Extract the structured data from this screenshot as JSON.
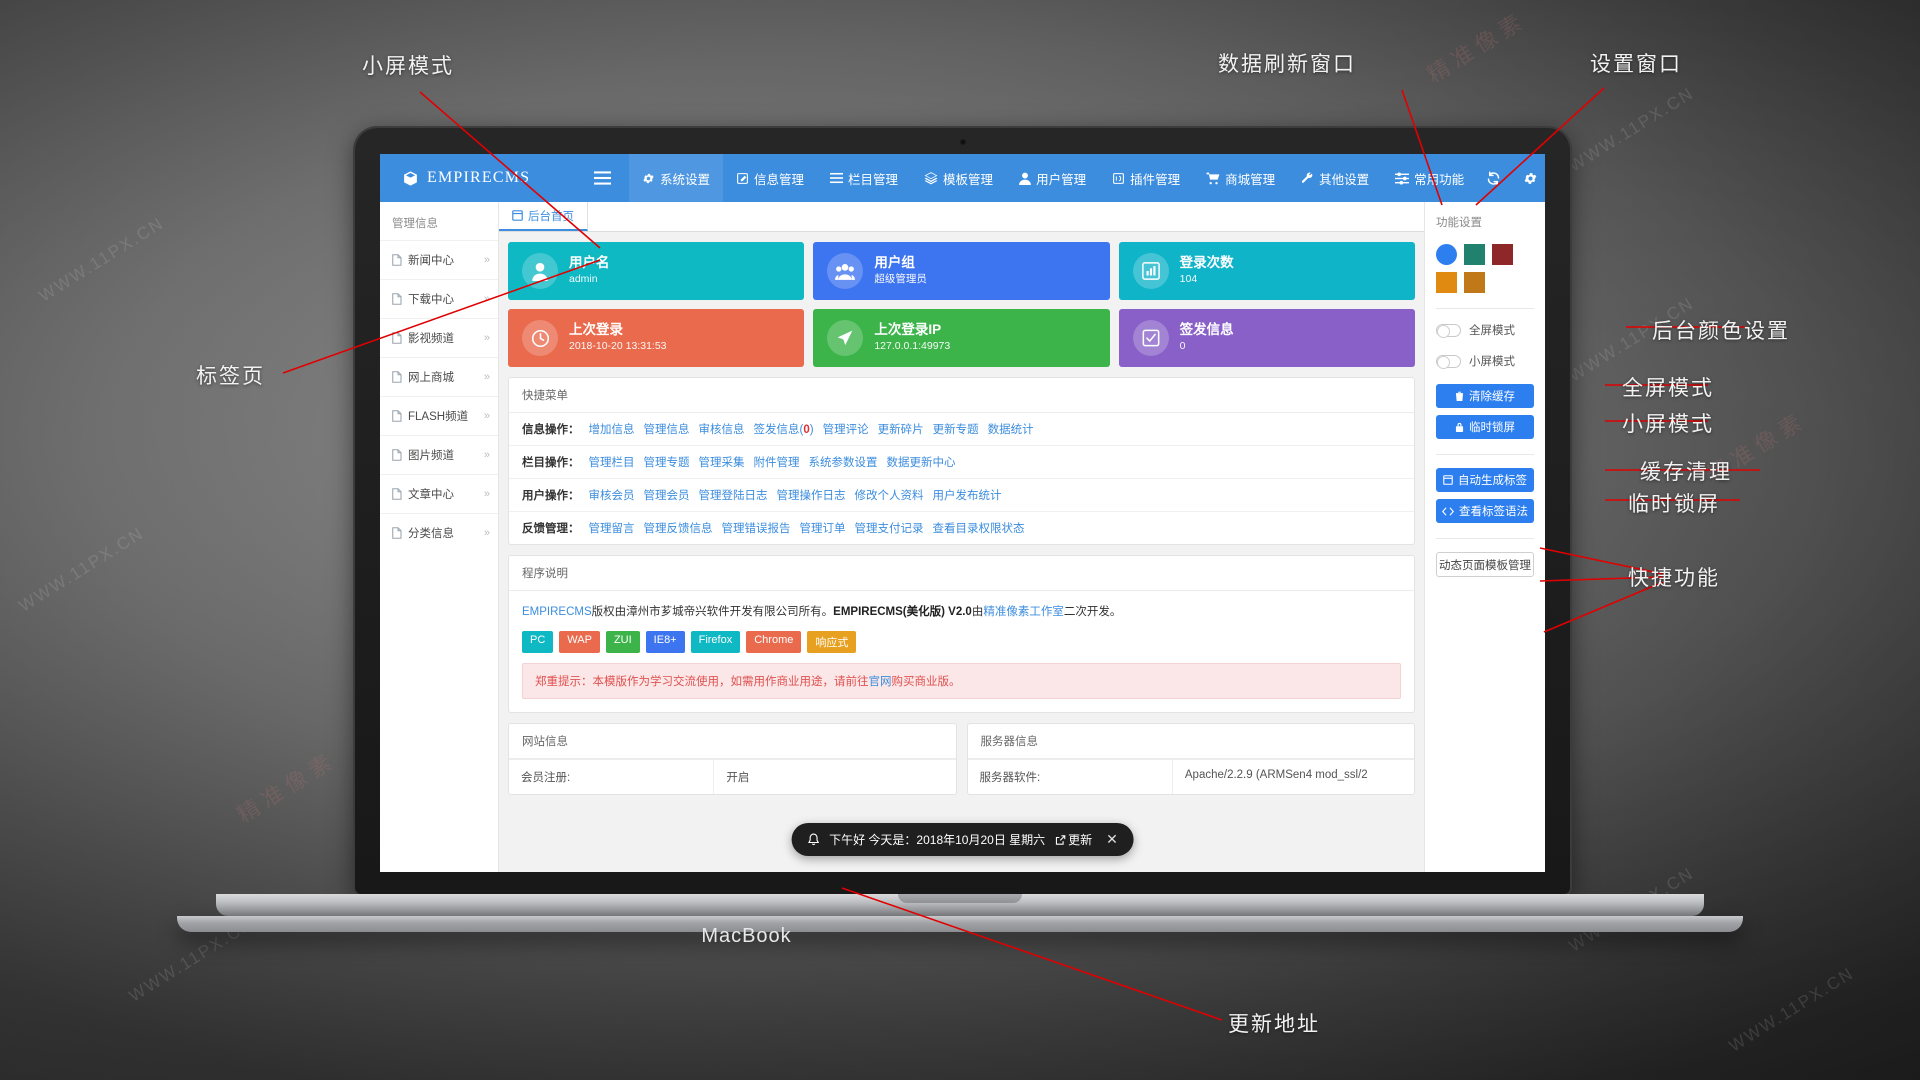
{
  "device": {
    "brand": "MacBook"
  },
  "navbar": {
    "logo": "EMPIRECMS",
    "items": [
      {
        "label": "系统设置",
        "icon": "gear-icon"
      },
      {
        "label": "信息管理",
        "icon": "edit-square-icon"
      },
      {
        "label": "栏目管理",
        "icon": "list-icon"
      },
      {
        "label": "模板管理",
        "icon": "layers-icon"
      },
      {
        "label": "用户管理",
        "icon": "user-icon"
      },
      {
        "label": "插件管理",
        "icon": "plugin-icon"
      },
      {
        "label": "商城管理",
        "icon": "cart-icon"
      },
      {
        "label": "其他设置",
        "icon": "wrench-icon"
      },
      {
        "label": "常用功能",
        "icon": "sliders-icon"
      }
    ],
    "right_icons": [
      {
        "name": "refresh-icon"
      },
      {
        "name": "gear-icon"
      },
      {
        "name": "user-caret-icon"
      }
    ]
  },
  "sidebar": {
    "title": "管理信息",
    "items": [
      {
        "label": "新闻中心",
        "chevron": "»"
      },
      {
        "label": "下载中心",
        "chevron": "»"
      },
      {
        "label": "影视频道",
        "chevron": "»"
      },
      {
        "label": "网上商城",
        "chevron": "»"
      },
      {
        "label": "FLASH频道",
        "chevron": "»"
      },
      {
        "label": "图片频道",
        "chevron": "»"
      },
      {
        "label": "文章中心",
        "chevron": "»"
      },
      {
        "label": "分类信息",
        "chevron": "»"
      }
    ]
  },
  "tabs": [
    {
      "label": "后台首页",
      "icon": "window-icon",
      "active": true
    }
  ],
  "cards_row1": [
    {
      "title": "用户名",
      "value": "admin",
      "color": "#0fb9c4",
      "icon": "user-icon"
    },
    {
      "title": "用户组",
      "value": "超级管理员",
      "color": "#3d74f0",
      "icon": "users-icon"
    },
    {
      "title": "登录次数",
      "value": "104",
      "color": "#10b4c8",
      "icon": "chart-bar-icon"
    }
  ],
  "cards_row2": [
    {
      "title": "上次登录",
      "value": "2018-10-20 13:31:53",
      "color": "#ea6a4d",
      "icon": "clock-icon"
    },
    {
      "title": "上次登录IP",
      "value": "127.0.0.1:49973",
      "color": "#3cb44a",
      "icon": "send-icon"
    },
    {
      "title": "签发信息",
      "value": "0",
      "color": "#8860c8",
      "icon": "check-square-icon"
    }
  ],
  "quick_menu": {
    "title": "快捷菜单",
    "rows": [
      {
        "label": "信息操作：",
        "links": [
          "增加信息",
          "管理信息",
          "审核信息",
          "签发信息(0)",
          "管理评论",
          "更新碎片",
          "更新专题",
          "数据统计"
        ]
      },
      {
        "label": "栏目操作：",
        "links": [
          "管理栏目",
          "管理专题",
          "管理采集",
          "附件管理",
          "系统参数设置",
          "数据更新中心"
        ]
      },
      {
        "label": "用户操作：",
        "links": [
          "审核会员",
          "管理会员",
          "管理登陆日志",
          "管理操作日志",
          "修改个人资料",
          "用户发布统计"
        ]
      },
      {
        "label": "反馈管理：",
        "links": [
          "管理留言",
          "管理反馈信息",
          "管理错误报告",
          "管理订单",
          "管理支付记录",
          "查看目录权限状态"
        ]
      }
    ]
  },
  "program_info": {
    "title": "程序说明",
    "desc_part1": "EMPIRECMS",
    "desc_part2": "版权由漳州市芗城帝兴软件开发有限公司所有。",
    "desc_part3": "EMPIRECMS(美化版) V2.0",
    "desc_part4": "由",
    "desc_part5": "精准像素工作室",
    "desc_part6": "二次开发。",
    "tags": [
      {
        "label": "PC",
        "color": "#0fb9c4"
      },
      {
        "label": "WAP",
        "color": "#ea6a4d"
      },
      {
        "label": "ZUI",
        "color": "#3cb44a"
      },
      {
        "label": "IE8+",
        "color": "#3d74f0"
      },
      {
        "label": "Firefox",
        "color": "#0fb9c4"
      },
      {
        "label": "Chrome",
        "color": "#ea6a4d"
      },
      {
        "label": "响应式",
        "color": "#e8a020"
      }
    ],
    "warning_part1": "郑重提示：本模版作为学习交流使用，如需用作商业用途，请前往",
    "warning_link": "官网",
    "warning_part2": "购买商业版。"
  },
  "site_info": {
    "title": "网站信息",
    "rows": [
      {
        "k": "会员注册:",
        "v": "开启"
      }
    ]
  },
  "server_info": {
    "title": "服务器信息",
    "rows": [
      {
        "k": "服务器软件:",
        "v": "Apache/2.2.9 (ARMSen4 mod_ssl/2"
      }
    ]
  },
  "settings_panel": {
    "title": "功能设置",
    "swatches": [
      {
        "color": "#2d7ff0",
        "active": true
      },
      {
        "color": "#20816f",
        "active": false
      },
      {
        "color": "#8e2828",
        "active": false
      },
      {
        "color": "#e08a12",
        "active": false
      },
      {
        "color": "#c07818",
        "active": false
      }
    ],
    "toggles": [
      {
        "label": "全屏模式",
        "on": false
      },
      {
        "label": "小屏模式",
        "on": false
      }
    ],
    "buttons": [
      {
        "label": "清除缓存",
        "icon": "trash-icon",
        "style": "primary"
      },
      {
        "label": "临时锁屏",
        "icon": "lock-icon",
        "style": "primary"
      },
      {
        "label": "自动生成标签",
        "icon": "window-icon",
        "style": "primary"
      },
      {
        "label": "查看标签语法",
        "icon": "code-icon",
        "style": "primary"
      },
      {
        "label": "动态页面模板管理",
        "icon": "",
        "style": "ghost"
      }
    ]
  },
  "toast": {
    "icon": "bell-icon",
    "message": "下午好 今天是：2018年10月20日 星期六",
    "action": "更新",
    "close": "✕"
  },
  "annotations": [
    {
      "id": "a1",
      "text": "小屏模式"
    },
    {
      "id": "a2",
      "text": "数据刷新窗口"
    },
    {
      "id": "a3",
      "text": "设置窗口"
    },
    {
      "id": "a4",
      "text": "后台颜色设置"
    },
    {
      "id": "a5",
      "text": "全屏模式"
    },
    {
      "id": "a6",
      "text": "小屏模式"
    },
    {
      "id": "a7",
      "text": "缓存清理"
    },
    {
      "id": "a8",
      "text": "临时锁屏"
    },
    {
      "id": "a9",
      "text": "快捷功能"
    },
    {
      "id": "a10",
      "text": "标签页"
    },
    {
      "id": "a11",
      "text": "更新地址"
    }
  ],
  "watermarks": [
    "WWW.11PX.CN",
    "WWW.11PX.CN",
    "WWW.11PX.CN",
    "WWW.11PX.CN",
    "精准像素 - WWW.11PX.CN",
    "精准像素",
    "精准像素"
  ]
}
